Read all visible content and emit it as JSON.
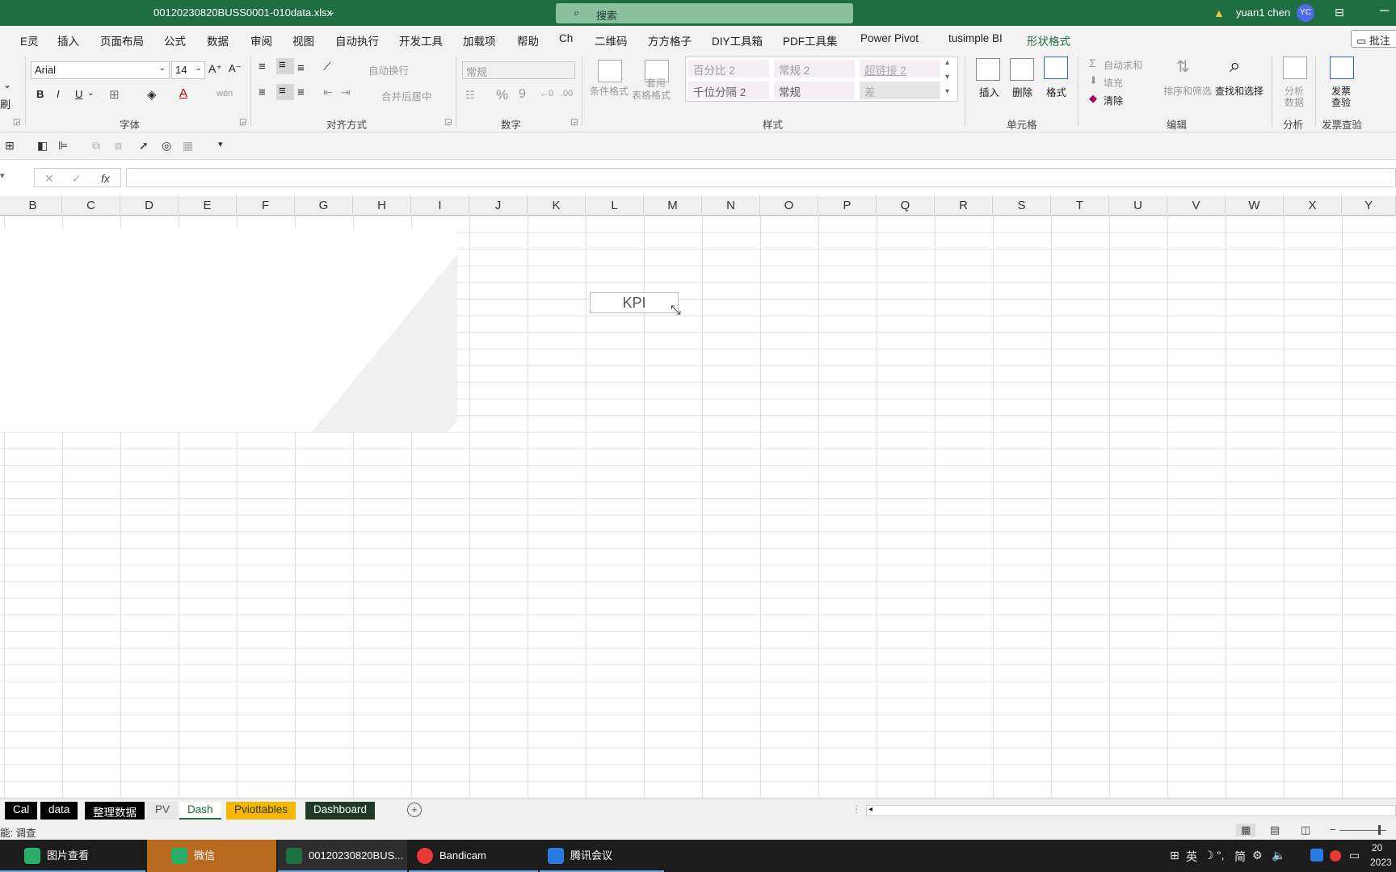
{
  "titlebar": {
    "filename": "00120230820BUSS0001-010data.xlsx",
    "search_placeholder": "搜索",
    "user_name": "yuan1 chen",
    "avatar_initials": "YC"
  },
  "menu": {
    "tabs": [
      "E灵",
      "插入",
      "页面布局",
      "公式",
      "数据",
      "审阅",
      "视图",
      "自动执行",
      "开发工具",
      "加载项",
      "帮助",
      "Ch",
      "二维码",
      "方方格子",
      "DIY工具箱",
      "PDF工具集",
      "Power Pivot",
      "tusimple BI",
      "形状格式"
    ],
    "active_tab": "形状格式",
    "comment_label": "批注"
  },
  "ribbon": {
    "clipboard_format_painter": "刷",
    "font_name": "Arial",
    "font_size": "14",
    "bold": "B",
    "italic": "I",
    "underline": "U",
    "font_group_label": "字体",
    "wrap_text": "自动换行",
    "merge_center": "合并后居中",
    "align_group_label": "对齐方式",
    "number_format": "常规",
    "percent": "%",
    "comma": "9",
    "number_group_label": "数字",
    "conditional_format": "条件格式",
    "table_format_line1": "套用",
    "table_format_line2": "表格格式",
    "styles": [
      "百分比 2",
      "常规 2",
      "超链接 2",
      "千位分隔 2",
      "常规",
      "差"
    ],
    "styles_group_label": "样式",
    "insert": "插入",
    "delete": "删除",
    "format": "格式",
    "cells_group_label": "单元格",
    "autosum": "自动求和",
    "fill": "填充",
    "clear": "清除",
    "sort_filter": "排序和筛选",
    "find_select": "查找和选择",
    "edit_group_label": "编辑",
    "analyze_line1": "分析",
    "analyze_line2": "数据",
    "analyze_group_label": "分析",
    "invoice_line1": "发票",
    "invoice_line2": "查验",
    "invoice_group_label": "发票查验"
  },
  "formula_bar": {
    "fx": "fx",
    "content": ""
  },
  "columns": [
    "B",
    "C",
    "D",
    "E",
    "F",
    "G",
    "H",
    "I",
    "J",
    "K",
    "L",
    "M",
    "N",
    "O",
    "P",
    "Q",
    "R",
    "S",
    "T",
    "U",
    "V",
    "W",
    "X",
    "Y"
  ],
  "canvas": {
    "kpi_label": "KPI"
  },
  "sheets": [
    {
      "name": "Cal",
      "style": "black"
    },
    {
      "name": "data",
      "style": "black"
    },
    {
      "name": "整理数据",
      "style": "black"
    },
    {
      "name": "PV",
      "style": "gray"
    },
    {
      "name": "Dash",
      "style": "active"
    },
    {
      "name": "Pviottables",
      "style": "gold"
    },
    {
      "name": "Dashboard",
      "style": "dark-green"
    }
  ],
  "statusbar": {
    "text": "能: 调查"
  },
  "taskbar": {
    "items": [
      {
        "label": "图片查看",
        "color": "#2aae67"
      },
      {
        "label": "微信",
        "color": "#2aae67"
      },
      {
        "label": "00120230820BUS...",
        "color": "#1e7145"
      },
      {
        "label": "Bandicam",
        "color": "#e53935"
      },
      {
        "label": "腾讯会议",
        "color": "#2a7ae2"
      }
    ],
    "tray_lang": "英",
    "tray_ime": "简",
    "clock_line1": "20",
    "clock_line2": "2023"
  }
}
